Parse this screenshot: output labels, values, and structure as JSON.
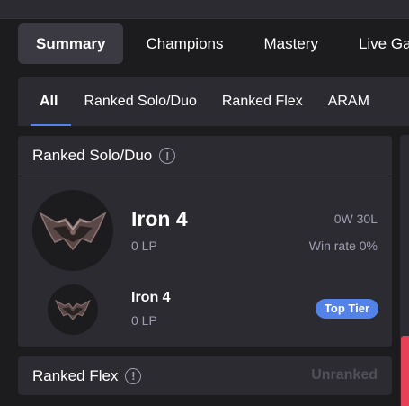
{
  "nav": {
    "tabs": [
      {
        "label": "Summary"
      },
      {
        "label": "Champions"
      },
      {
        "label": "Mastery"
      },
      {
        "label": "Live Ga"
      }
    ]
  },
  "queue_tabs": [
    {
      "label": "All"
    },
    {
      "label": "Ranked Solo/Duo"
    },
    {
      "label": "Ranked Flex"
    },
    {
      "label": "ARAM"
    }
  ],
  "solo": {
    "title": "Ranked Solo/Duo",
    "info_glyph": "!",
    "tier": "Iron 4",
    "lp": "0 LP",
    "record": "0W 30L",
    "win_rate": "Win rate 0%",
    "peak_tier": "Iron 4",
    "peak_lp": "0 LP",
    "badge": "Top Tier"
  },
  "flex": {
    "title": "Ranked Flex",
    "info_glyph": "!",
    "status": "Unranked"
  },
  "colors": {
    "background": "#1c1c1f",
    "panel": "#2c2b31",
    "accent": "#5383e8",
    "muted_text": "#9e9eb1",
    "loss_red": "#e84057"
  },
  "icons": {
    "info": "info-icon",
    "emblem": "iron-emblem-icon"
  }
}
